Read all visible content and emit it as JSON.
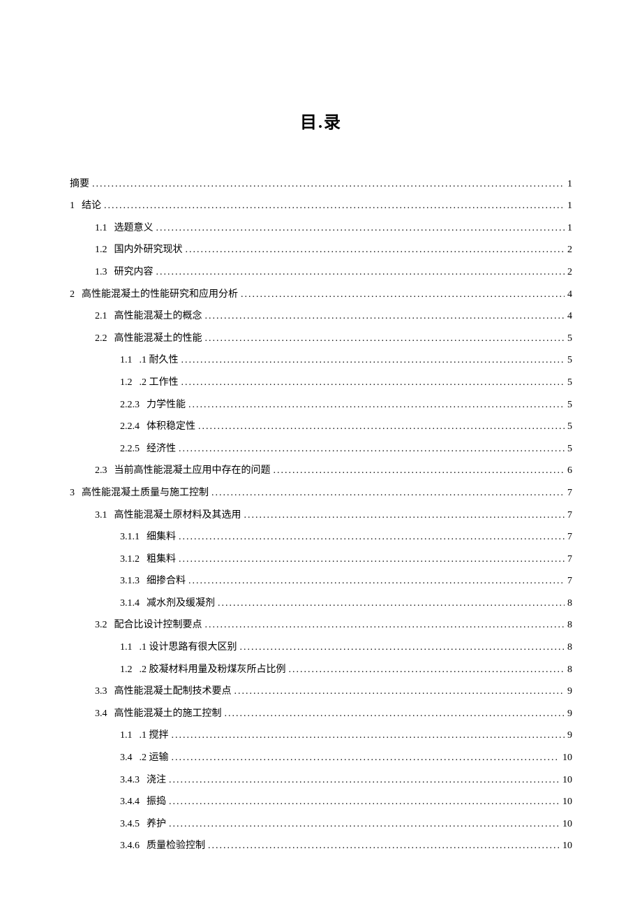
{
  "title": "目.录",
  "toc": [
    {
      "level": 0,
      "num": "",
      "label": "摘要",
      "page": "1"
    },
    {
      "level": 0,
      "num": "1",
      "label": "结论",
      "page": "1"
    },
    {
      "level": 1,
      "num": "1.1",
      "label": "选题意义",
      "page": "1"
    },
    {
      "level": 1,
      "num": "1.2",
      "label": "国内外研究现状",
      "page": "2"
    },
    {
      "level": 1,
      "num": "1.3",
      "label": "研究内容",
      "page": "2"
    },
    {
      "level": 0,
      "num": "2",
      "label": "高性能混凝土的性能研究和应用分析",
      "page": "4"
    },
    {
      "level": 1,
      "num": "2.1",
      "label": "高性能混凝土的概念",
      "page": "4"
    },
    {
      "level": 1,
      "num": "2.2",
      "label": "高性能混凝土的性能",
      "page": "5"
    },
    {
      "level": 2,
      "num": "1.1",
      "label": ".1 耐久性",
      "page": "5"
    },
    {
      "level": 2,
      "num": "1.2",
      "label": ".2 工作性",
      "page": "5"
    },
    {
      "level": 2,
      "num": "2.2.3",
      "label": "力学性能",
      "page": "5"
    },
    {
      "level": 2,
      "num": "2.2.4",
      "label": "体积稳定性",
      "page": "5"
    },
    {
      "level": 2,
      "num": "2.2.5",
      "label": "经济性",
      "page": "5"
    },
    {
      "level": 1,
      "num": "2.3",
      "label": "当前高性能混凝土应用中存在的问题",
      "page": "6"
    },
    {
      "level": 0,
      "num": "3",
      "label": "高性能混凝土质量与施工控制",
      "page": "7"
    },
    {
      "level": 1,
      "num": "3.1",
      "label": "高性能混凝土原材料及其选用",
      "page": "7"
    },
    {
      "level": 2,
      "num": "3.1.1",
      "label": "细集料",
      "page": "7"
    },
    {
      "level": 2,
      "num": "3.1.2",
      "label": "粗集料",
      "page": "7"
    },
    {
      "level": 2,
      "num": "3.1.3",
      "label": "细掺合料",
      "page": "7"
    },
    {
      "level": 2,
      "num": "3.1.4",
      "label": "减水剂及缓凝剂",
      "page": "8"
    },
    {
      "level": 1,
      "num": "3.2",
      "label": "配合比设计控制要点",
      "page": "8"
    },
    {
      "level": 2,
      "num": "1.1",
      "label": ".1 设计思路有很大区别",
      "page": "8"
    },
    {
      "level": 2,
      "num": "1.2",
      "label": ".2 胶凝材料用量及粉煤灰所占比例",
      "page": "8"
    },
    {
      "level": 1,
      "num": "3.3",
      "label": "高性能混凝土配制技术要点",
      "page": "9"
    },
    {
      "level": 1,
      "num": "3.4",
      "label": "高性能混凝土的施工控制",
      "page": "9"
    },
    {
      "level": 2,
      "num": "1.1",
      "label": ".1 搅拌",
      "page": "9"
    },
    {
      "level": 2,
      "num": "3.4",
      "label": ".2 运输",
      "page": "10"
    },
    {
      "level": 2,
      "num": "3.4.3",
      "label": "浇注",
      "page": "10"
    },
    {
      "level": 2,
      "num": "3.4.4",
      "label": "振捣",
      "page": "10"
    },
    {
      "level": 2,
      "num": "3.4.5",
      "label": "养护",
      "page": "10"
    },
    {
      "level": 2,
      "num": "3.4.6",
      "label": "质量检验控制",
      "page": "10"
    }
  ]
}
